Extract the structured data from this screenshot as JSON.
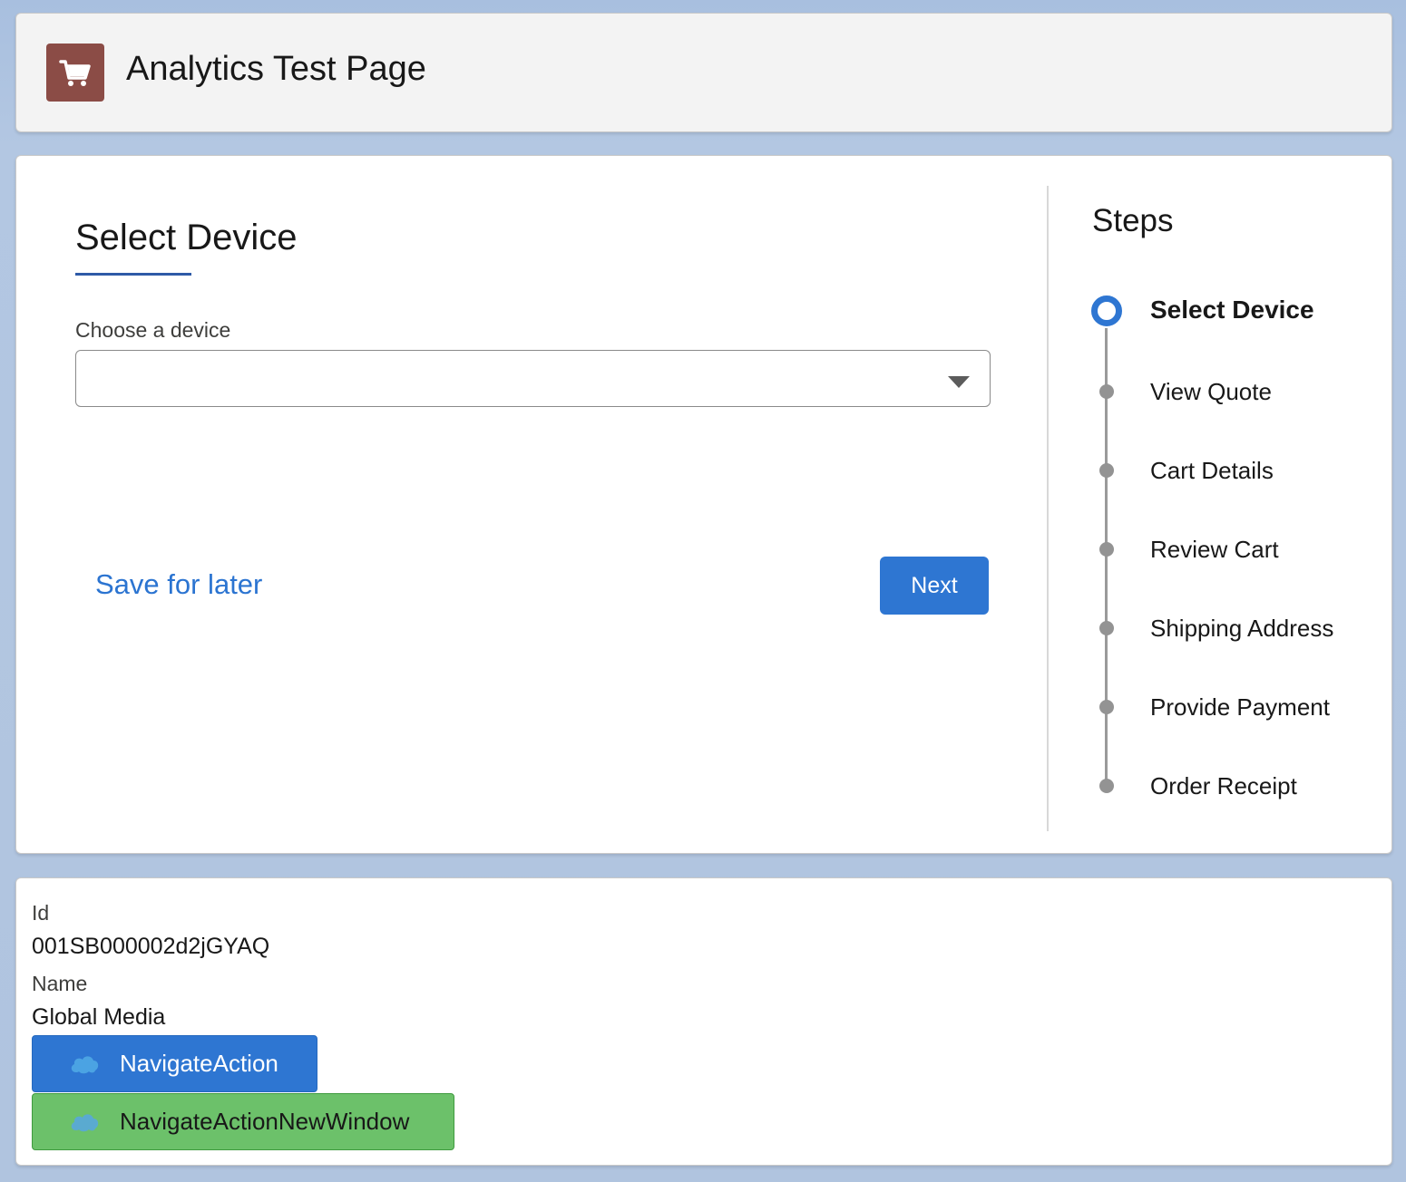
{
  "header": {
    "title": "Analytics Test Page",
    "icon": "shopping-cart-icon",
    "icon_color": "#8b4c46"
  },
  "form": {
    "title": "Select Device",
    "field_label": "Choose a device",
    "selected_value": "",
    "save_link": "Save for later",
    "next_button": "Next"
  },
  "steps": {
    "title": "Steps",
    "items": [
      {
        "label": "Select Device",
        "active": true
      },
      {
        "label": "View Quote",
        "active": false
      },
      {
        "label": "Cart Details",
        "active": false
      },
      {
        "label": "Review Cart",
        "active": false
      },
      {
        "label": "Shipping Address",
        "active": false
      },
      {
        "label": "Provide Payment",
        "active": false
      },
      {
        "label": "Order Receipt",
        "active": false
      }
    ]
  },
  "record": {
    "id_label": "Id",
    "id_value": "001SB000002d2jGYAQ",
    "name_label": "Name",
    "name_value": "Global Media"
  },
  "actions": {
    "navigate": "NavigateAction",
    "navigate_new_window": "NavigateActionNewWindow"
  },
  "colors": {
    "brand_blue": "#2e76d2",
    "green": "#6cc16a",
    "link": "#2b74d1"
  }
}
